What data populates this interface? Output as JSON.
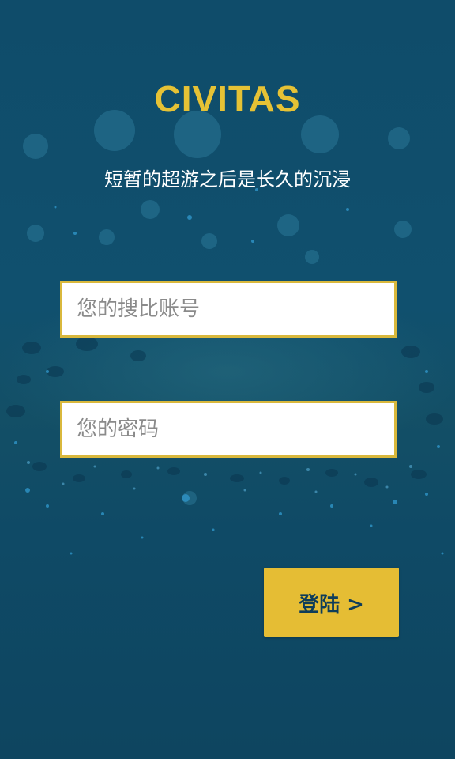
{
  "app": {
    "title": "CIVITAS",
    "tagline": "短暂的超游之后是长久的沉浸"
  },
  "form": {
    "account_placeholder": "您的搜比账号",
    "account_value": "",
    "password_placeholder": "您的密码",
    "password_value": "",
    "login_label": "登陆 >"
  },
  "colors": {
    "background": "#0f4a66",
    "accent": "#e6c235",
    "button_bg": "#e5bd34",
    "button_text": "#0e3d5a",
    "field_border": "#d9b83c"
  }
}
